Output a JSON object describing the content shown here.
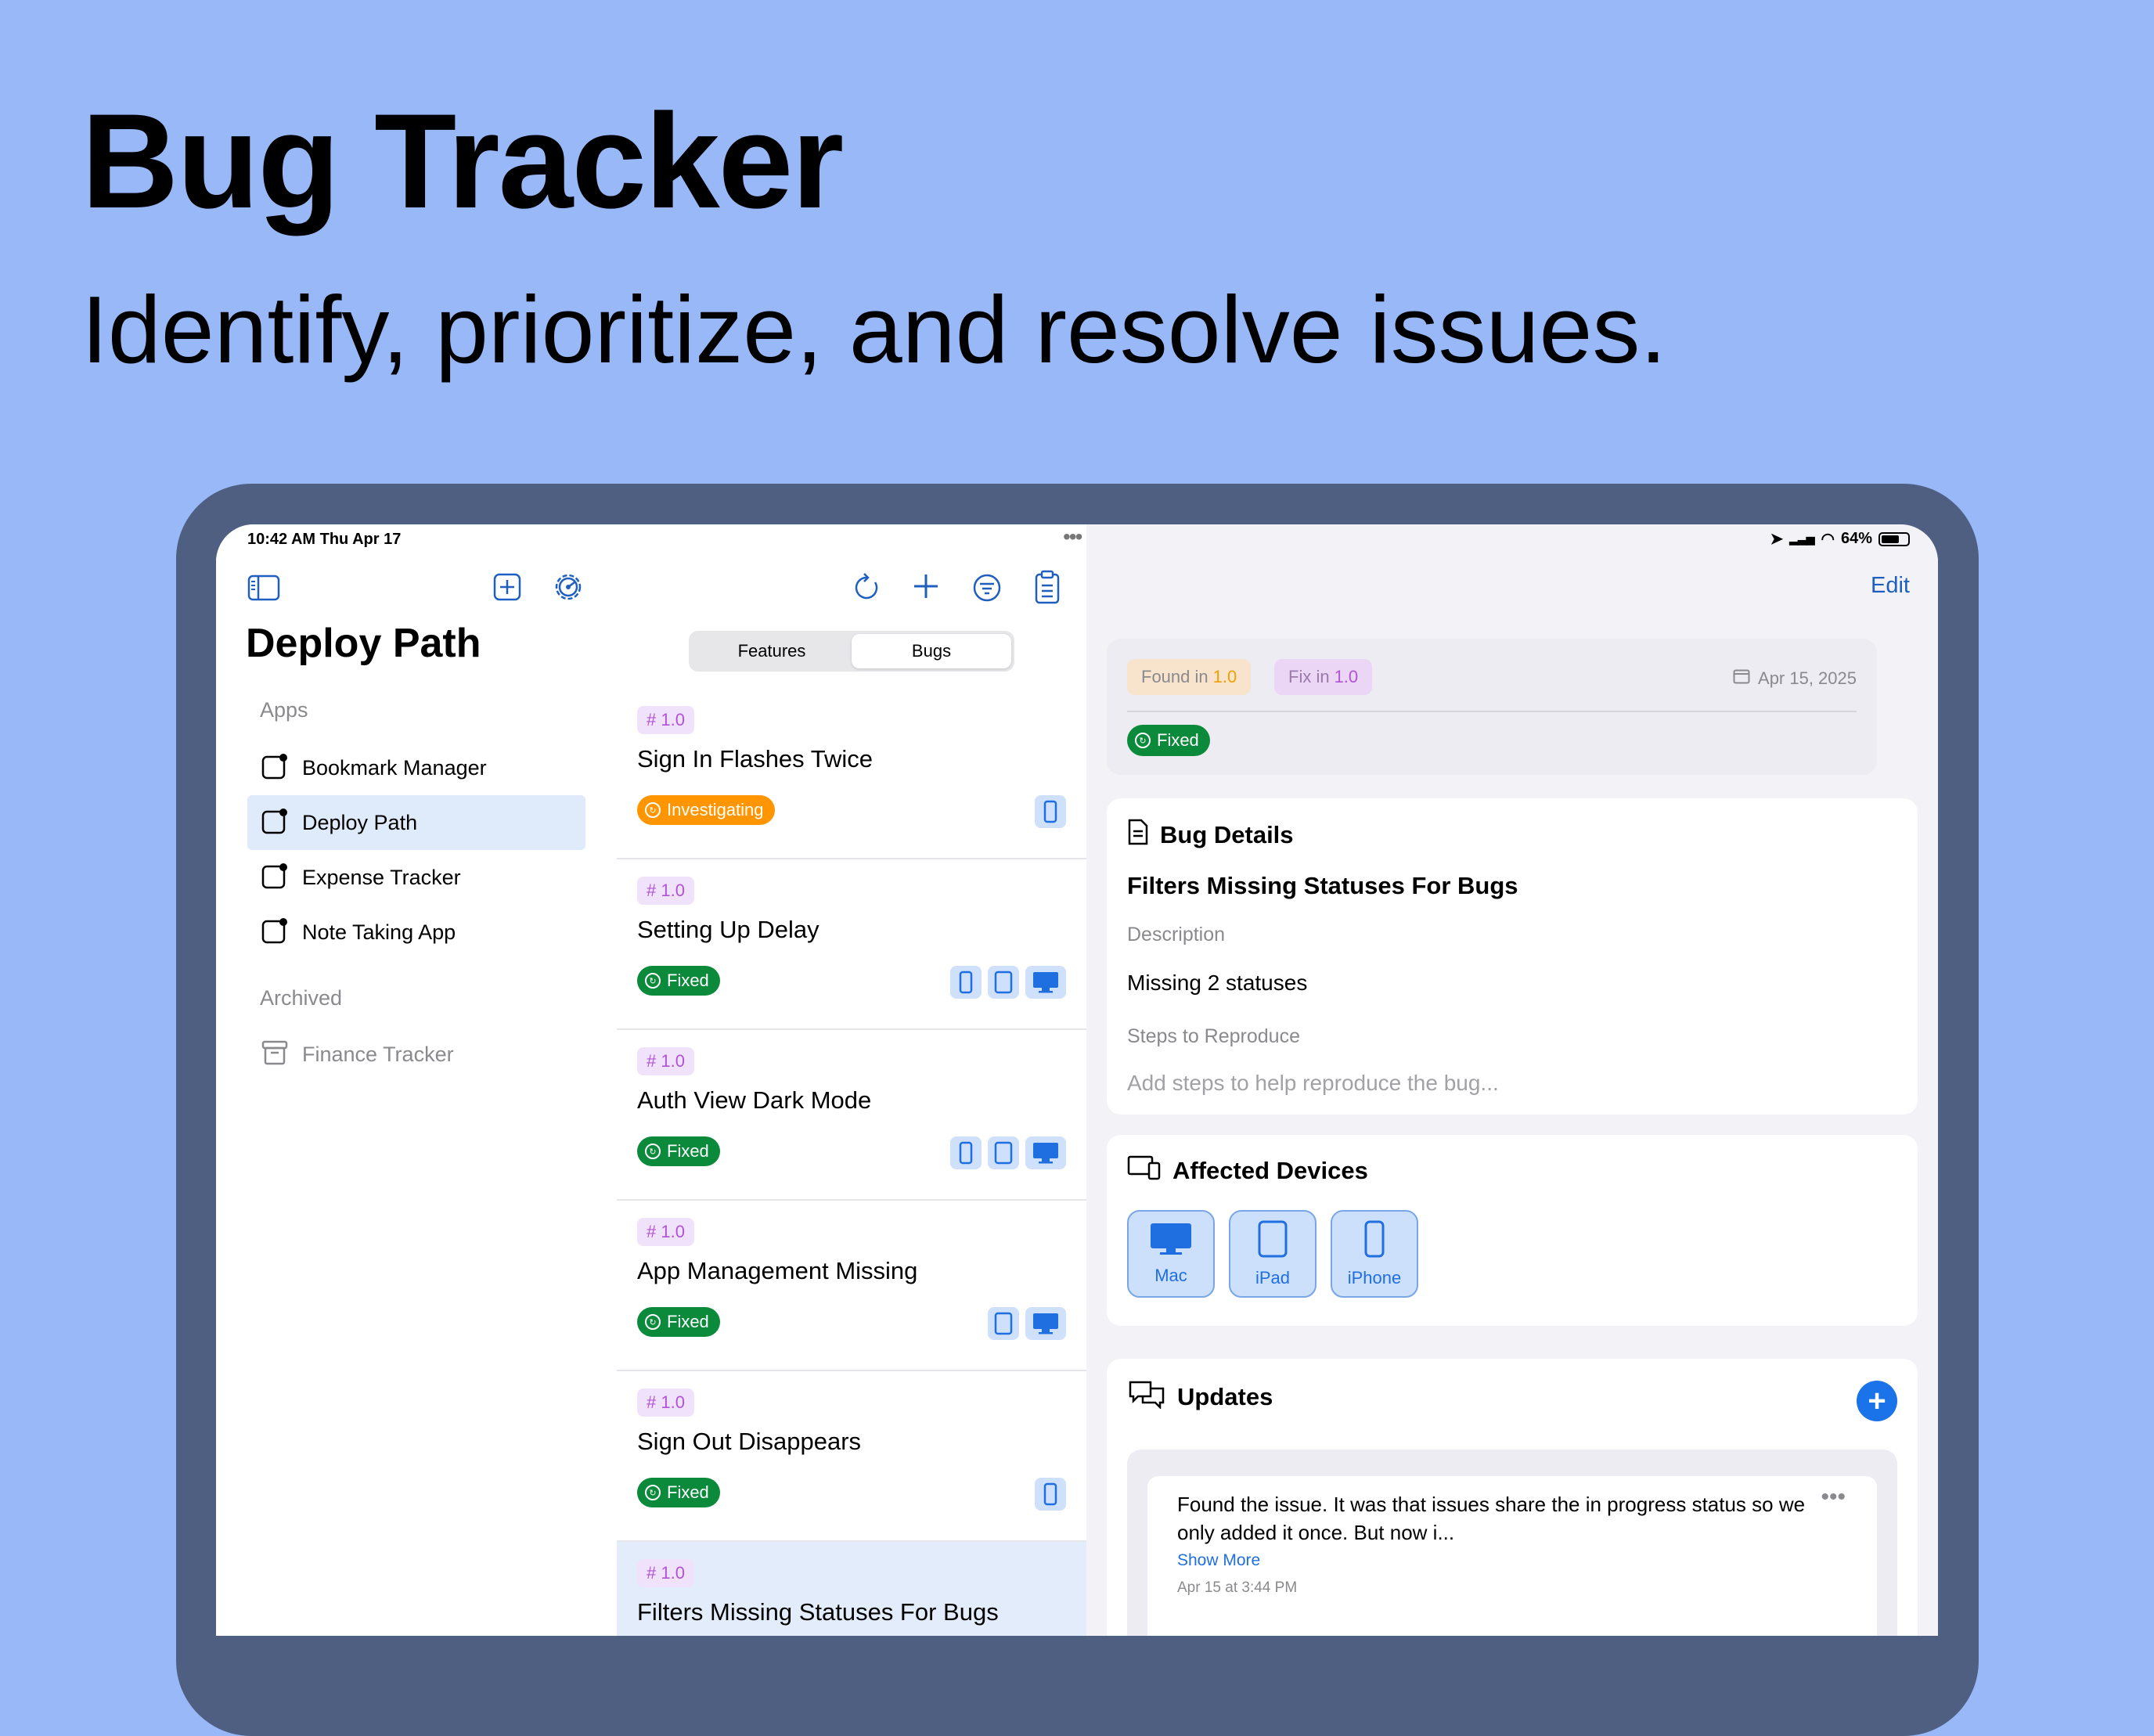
{
  "hero": {
    "title": "Bug Tracker",
    "subtitle": "Identify, prioritize, and resolve issues."
  },
  "status_bar": {
    "time": "10:42 AM   Thu Apr 17",
    "battery": "64%"
  },
  "sidebar": {
    "title": "Deploy Path",
    "apps_section": "Apps",
    "items": [
      {
        "label": "Bookmark Manager"
      },
      {
        "label": "Deploy Path"
      },
      {
        "label": "Expense Tracker"
      },
      {
        "label": "Note Taking App"
      }
    ],
    "archived_section": "Archived",
    "archived_items": [
      {
        "label": "Finance Tracker"
      }
    ]
  },
  "list": {
    "segments": [
      "Features",
      "Bugs"
    ],
    "selected_segment": "Bugs",
    "bugs": [
      {
        "version": "# 1.0",
        "title": "Sign In Flashes Twice",
        "status": "Investigating",
        "devices": [
          "iphone"
        ]
      },
      {
        "version": "# 1.0",
        "title": "Setting Up Delay",
        "status": "Fixed",
        "devices": [
          "iphone",
          "ipad",
          "mac"
        ]
      },
      {
        "version": "# 1.0",
        "title": "Auth View Dark Mode",
        "status": "Fixed",
        "devices": [
          "iphone",
          "ipad",
          "mac"
        ]
      },
      {
        "version": "# 1.0",
        "title": "App Management Missing",
        "status": "Fixed",
        "devices": [
          "ipad",
          "mac"
        ]
      },
      {
        "version": "# 1.0",
        "title": "Sign Out Disappears",
        "status": "Fixed",
        "devices": [
          "iphone"
        ]
      },
      {
        "version": "# 1.0",
        "title": "Filters Missing Statuses For Bugs",
        "status": "Fixed",
        "devices": []
      }
    ]
  },
  "detail": {
    "edit_label": "Edit",
    "found_in_label": "Found in",
    "found_in_value": "1.0",
    "fix_in_label": "Fix in",
    "fix_in_value": "1.0",
    "date": "Apr 15, 2025",
    "status": "Fixed",
    "bug_details_header": "Bug Details",
    "bug_title": "Filters Missing Statuses For Bugs",
    "description_label": "Description",
    "description_value": "Missing 2 statuses",
    "steps_label": "Steps to Reproduce",
    "steps_placeholder": "Add steps to help reproduce the bug...",
    "affected_header": "Affected Devices",
    "devices": [
      {
        "label": "Mac",
        "icon": "mac-icon"
      },
      {
        "label": "iPad",
        "icon": "ipad-icon"
      },
      {
        "label": "iPhone",
        "icon": "iphone-icon"
      }
    ],
    "updates_header": "Updates",
    "update": {
      "text": "Found the issue. It was that issues share the in progress status so we only added it once. But now i...",
      "more": "Show More",
      "time": "Apr 15 at 3:44 PM"
    }
  },
  "colors": {
    "background": "#99b8f8",
    "accent": "#1f5fbf",
    "fixed_green": "#0a8a3a",
    "investigating_orange": "#ff9500",
    "version_purple": "#b054d6"
  }
}
